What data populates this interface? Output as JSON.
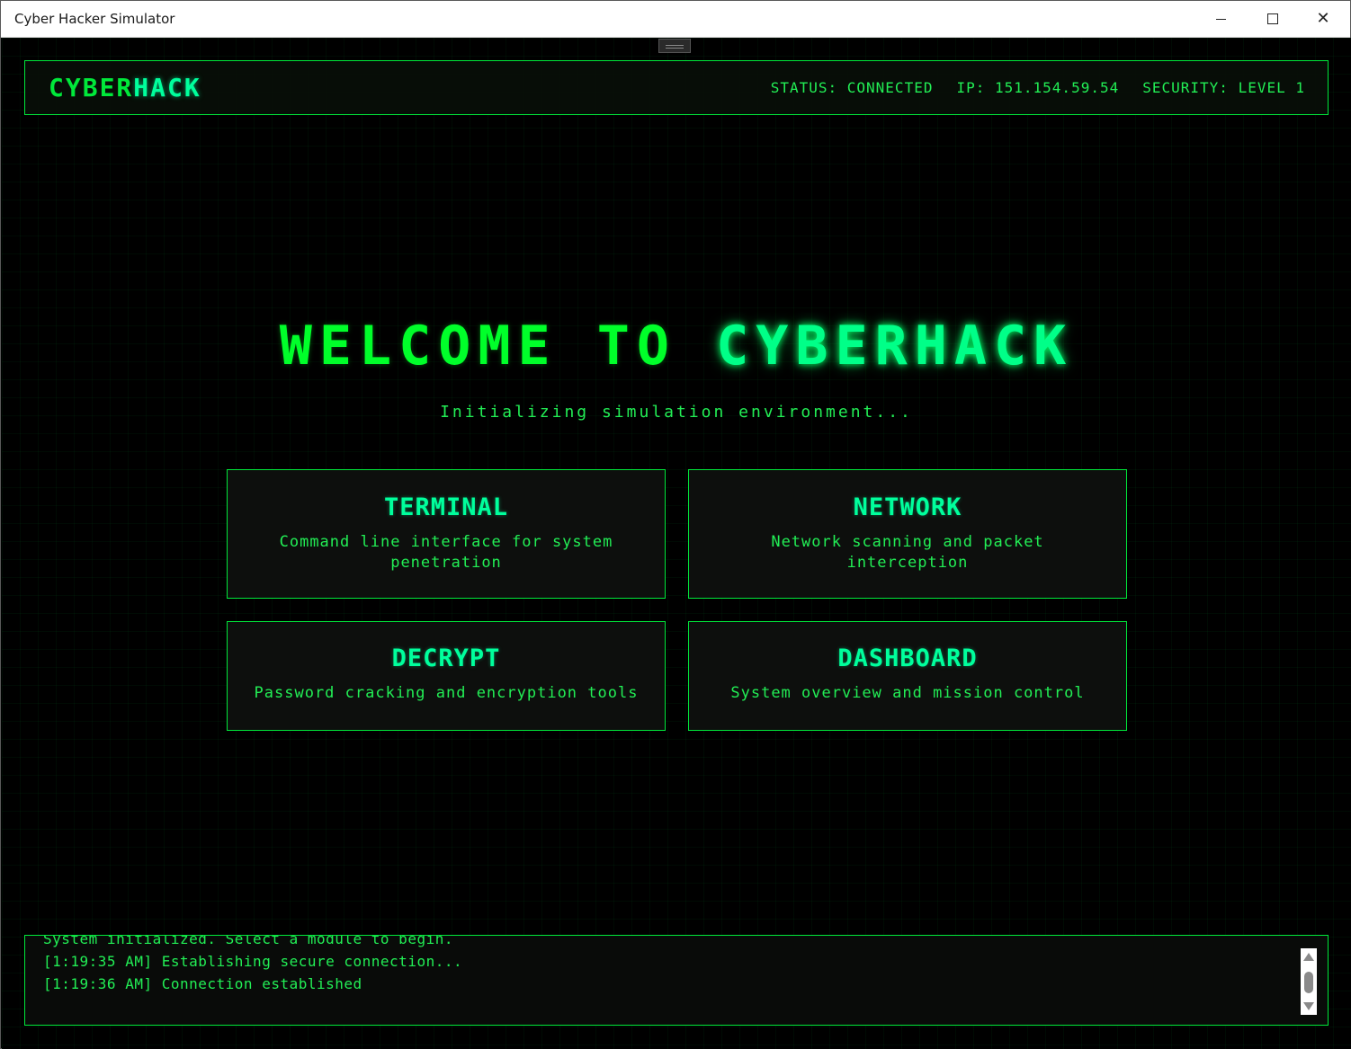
{
  "window": {
    "title": "Cyber Hacker Simulator"
  },
  "header": {
    "logo_part1": "CYBER",
    "logo_part2": "HACK",
    "status": "STATUS: CONNECTED",
    "ip": "IP: 151.154.59.54",
    "security": "SECURITY: LEVEL 1"
  },
  "hero": {
    "welcome_part1": "WELCOME TO ",
    "welcome_part2": "CYBERHACK",
    "subtitle": "Initializing simulation environment..."
  },
  "modules": [
    {
      "title": "TERMINAL",
      "description": "Command line interface for system penetration"
    },
    {
      "title": "NETWORK",
      "description": "Network scanning and packet interception"
    },
    {
      "title": "DECRYPT",
      "description": "Password cracking and encryption tools"
    },
    {
      "title": "DASHBOARD",
      "description": "System overview and mission control"
    }
  ],
  "console": {
    "lines": [
      "System initialized. Select a module to begin.",
      "[1:19:35 AM] Establishing secure connection...",
      "[1:19:36 AM] Connection established"
    ]
  },
  "colors": {
    "primary_green": "#00e83a",
    "accent_green": "#00ff9c",
    "background": "#000000"
  }
}
